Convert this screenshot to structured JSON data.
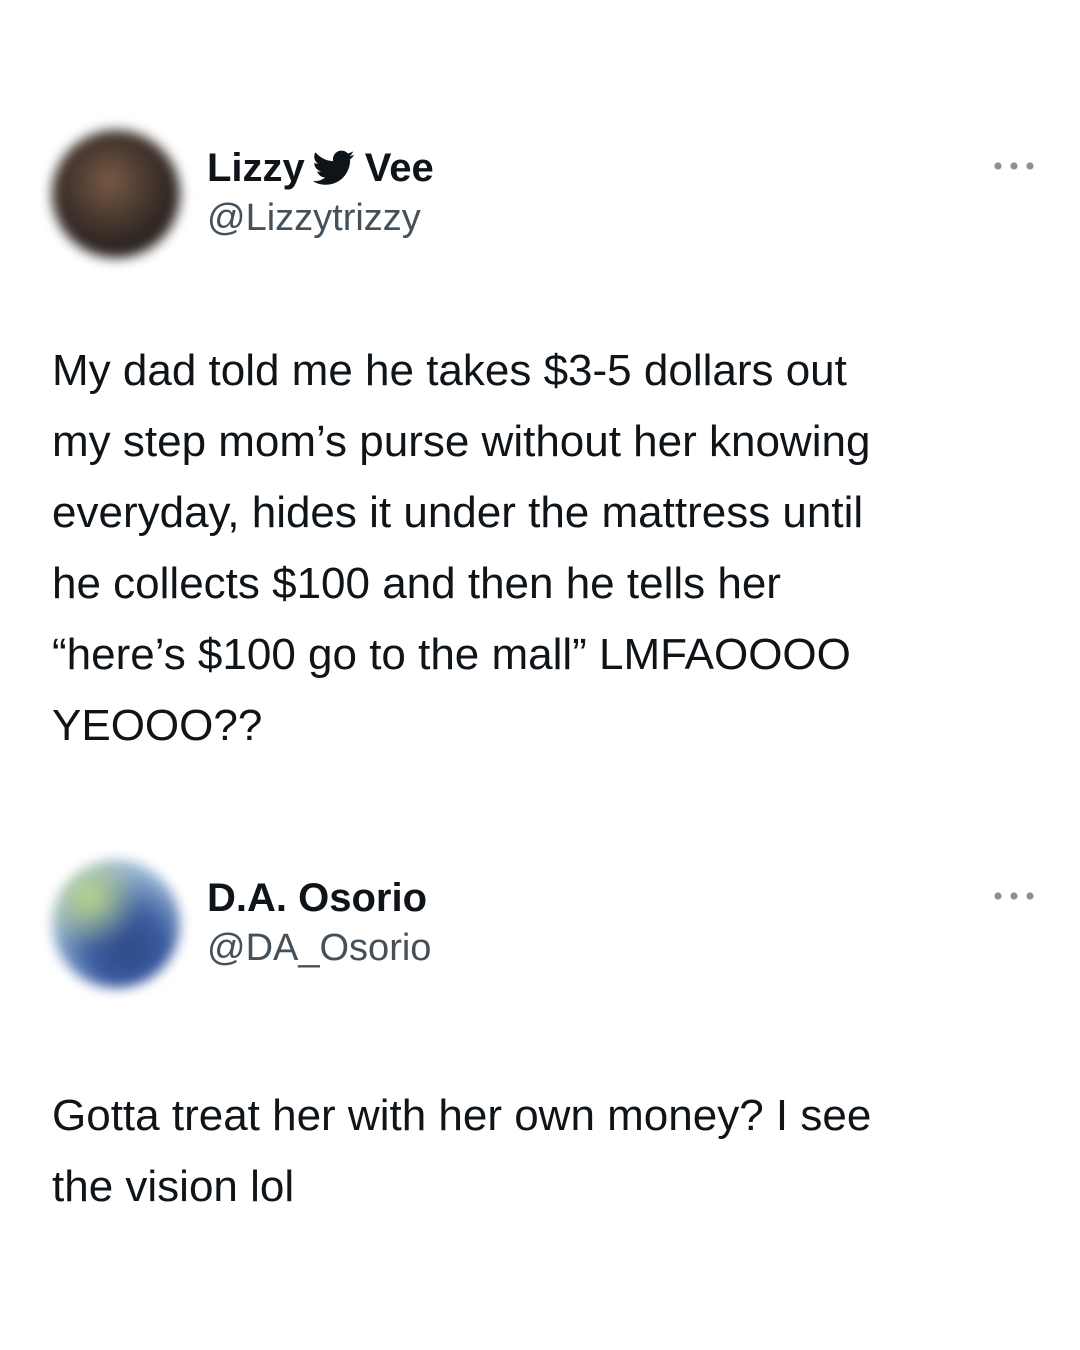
{
  "tweets": [
    {
      "display_name_first": "Lizzy",
      "display_name_second": "Vee",
      "handle": "@Lizzytrizzy",
      "text": "My dad told me he takes $3-5 dollars out\nmy step mom’s purse without her knowing\neveryday, hides it under the mattress until\nhe collects $100 and then he tells her\n“here’s $100 go to the mall” LMFAOOOO\nYEOOO??",
      "name_icon": "bird-icon",
      "menu_icon": "more-icon"
    },
    {
      "display_name": "D.A. Osorio",
      "handle": "@DA_Osorio",
      "text": "Gotta treat her with her own money? I see\nthe vision lol",
      "menu_icon": "more-icon"
    }
  ],
  "colors": {
    "text": "#0f1419",
    "handle": "#44505a",
    "icon": "#8a9199",
    "background": "#ffffff"
  }
}
